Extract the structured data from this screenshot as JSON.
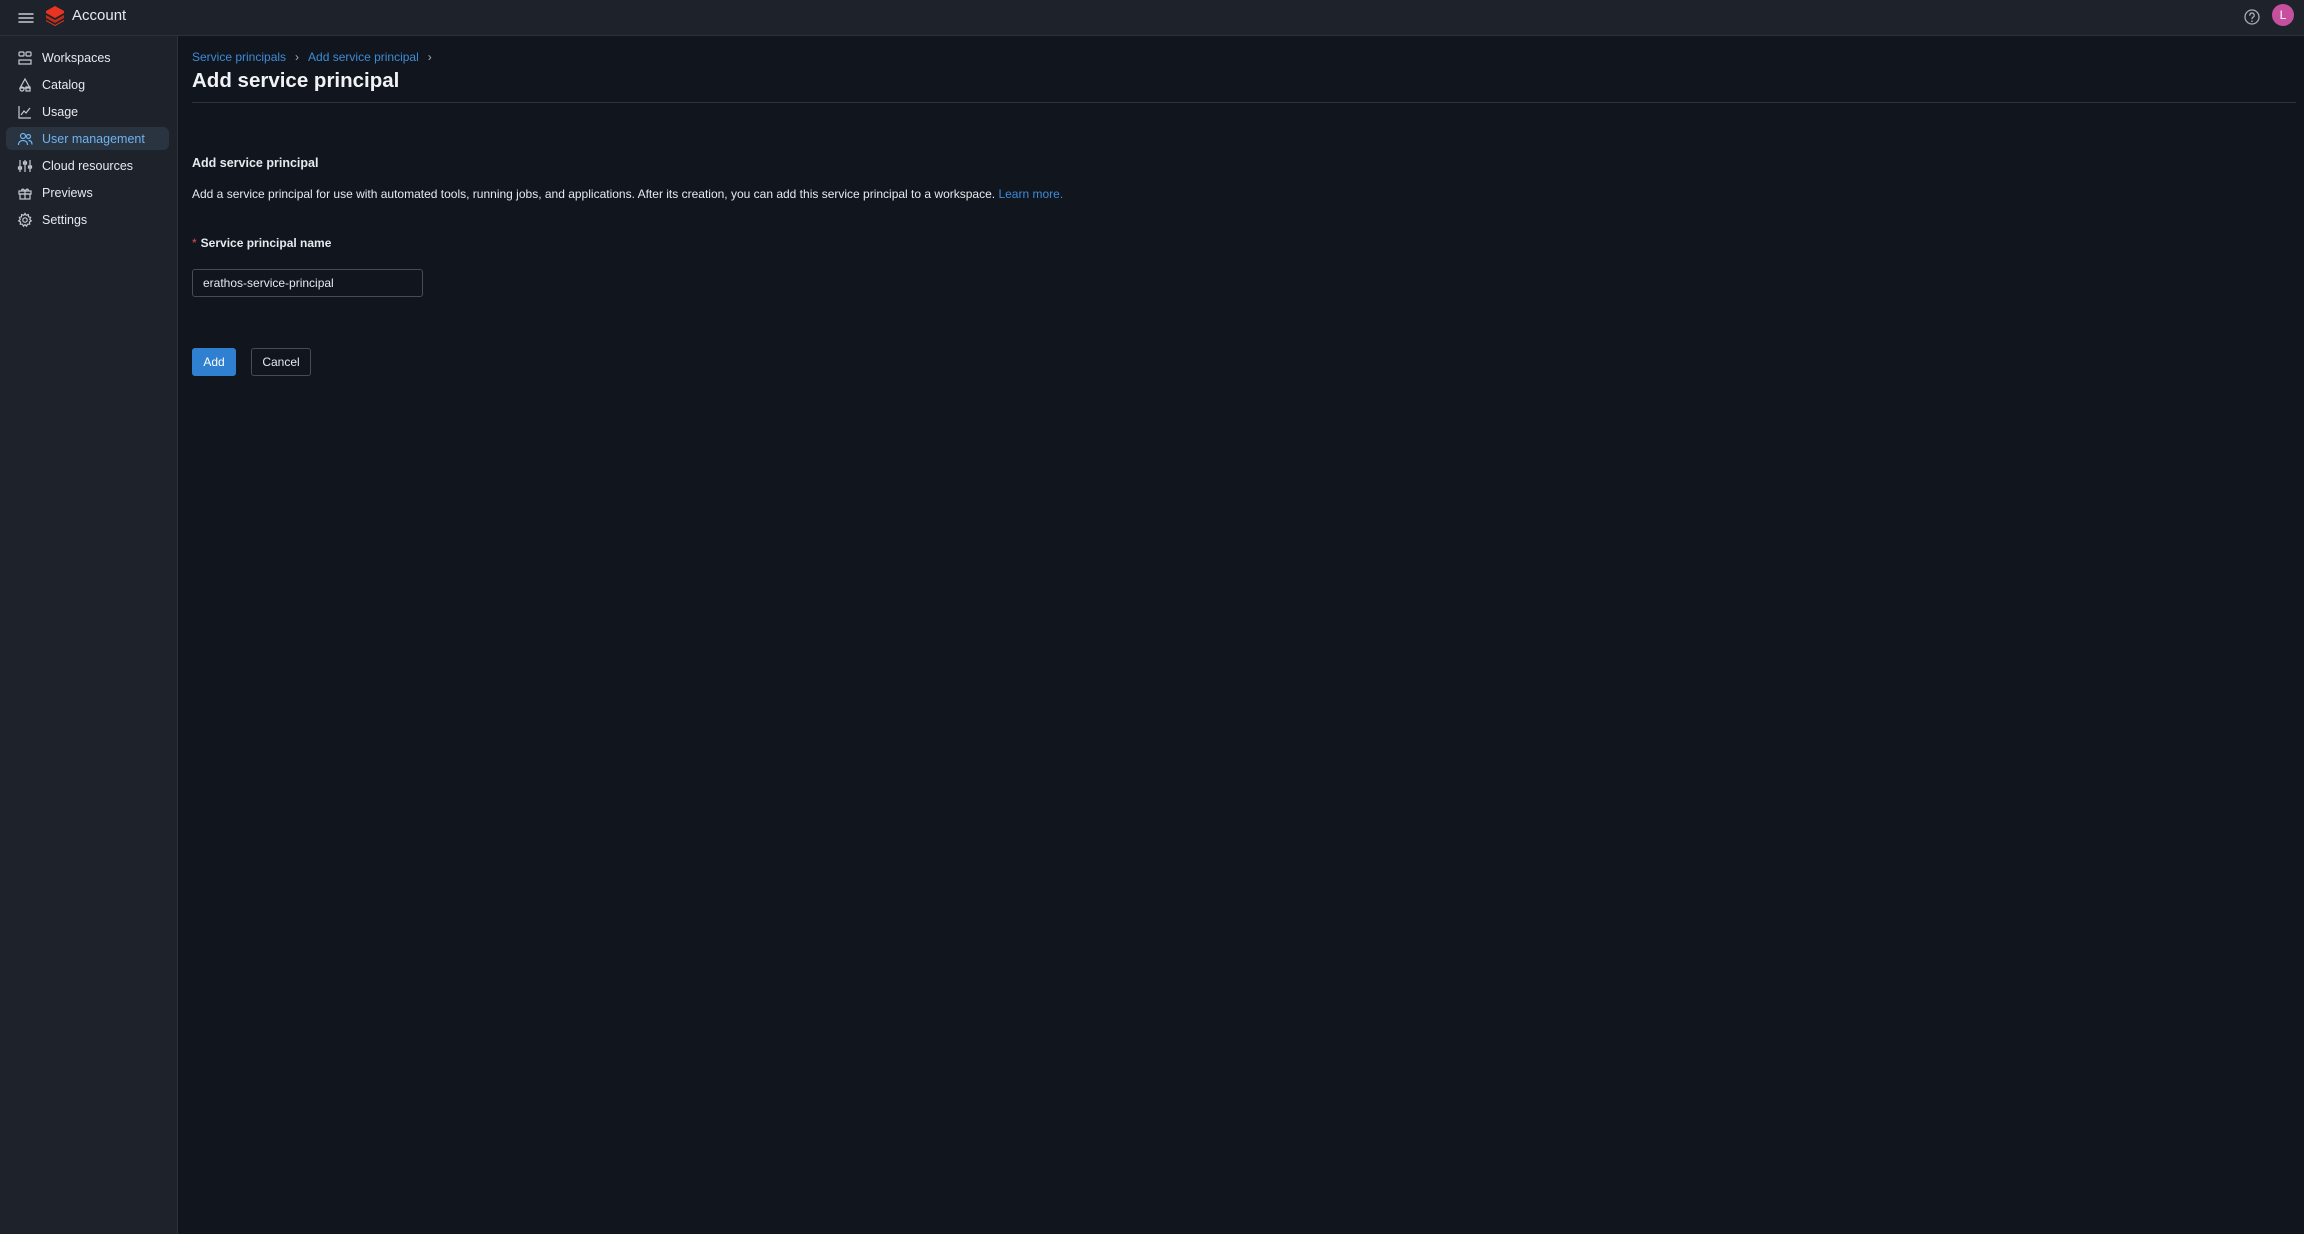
{
  "topbar": {
    "title": "Account",
    "avatar_initial": "L",
    "icons": {
      "menu": "hamburger-icon",
      "logo": "databricks-logo-icon",
      "help": "question-circle-icon"
    }
  },
  "sidebar": {
    "items": [
      {
        "label": "Workspaces",
        "icon": "workspaces-icon",
        "active": false
      },
      {
        "label": "Catalog",
        "icon": "catalog-icon",
        "active": false
      },
      {
        "label": "Usage",
        "icon": "chart-line-icon",
        "active": false
      },
      {
        "label": "User management",
        "icon": "users-icon",
        "active": true
      },
      {
        "label": "Cloud resources",
        "icon": "sliders-icon",
        "active": false
      },
      {
        "label": "Previews",
        "icon": "gift-icon",
        "active": false
      },
      {
        "label": "Settings",
        "icon": "gear-icon",
        "active": false
      }
    ]
  },
  "breadcrumb": {
    "items": [
      "Service principals",
      "Add service principal"
    ],
    "separator": "›"
  },
  "page": {
    "title": "Add service principal",
    "section_title": "Add service principal",
    "description": "Add a service principal for use with automated tools, running jobs, and applications. After its creation, you can add this service principal to a workspace.",
    "learn_more": "Learn more."
  },
  "form": {
    "name_label": "Service principal name",
    "required_marker": "*",
    "name_value": "erathos-service-principal"
  },
  "actions": {
    "add_label": "Add",
    "cancel_label": "Cancel"
  },
  "colors": {
    "accent": "#2f80d1",
    "link": "#3d8bd6",
    "background": "#11161e",
    "sidebar": "#1e232b",
    "avatar": "#c64f9e"
  }
}
